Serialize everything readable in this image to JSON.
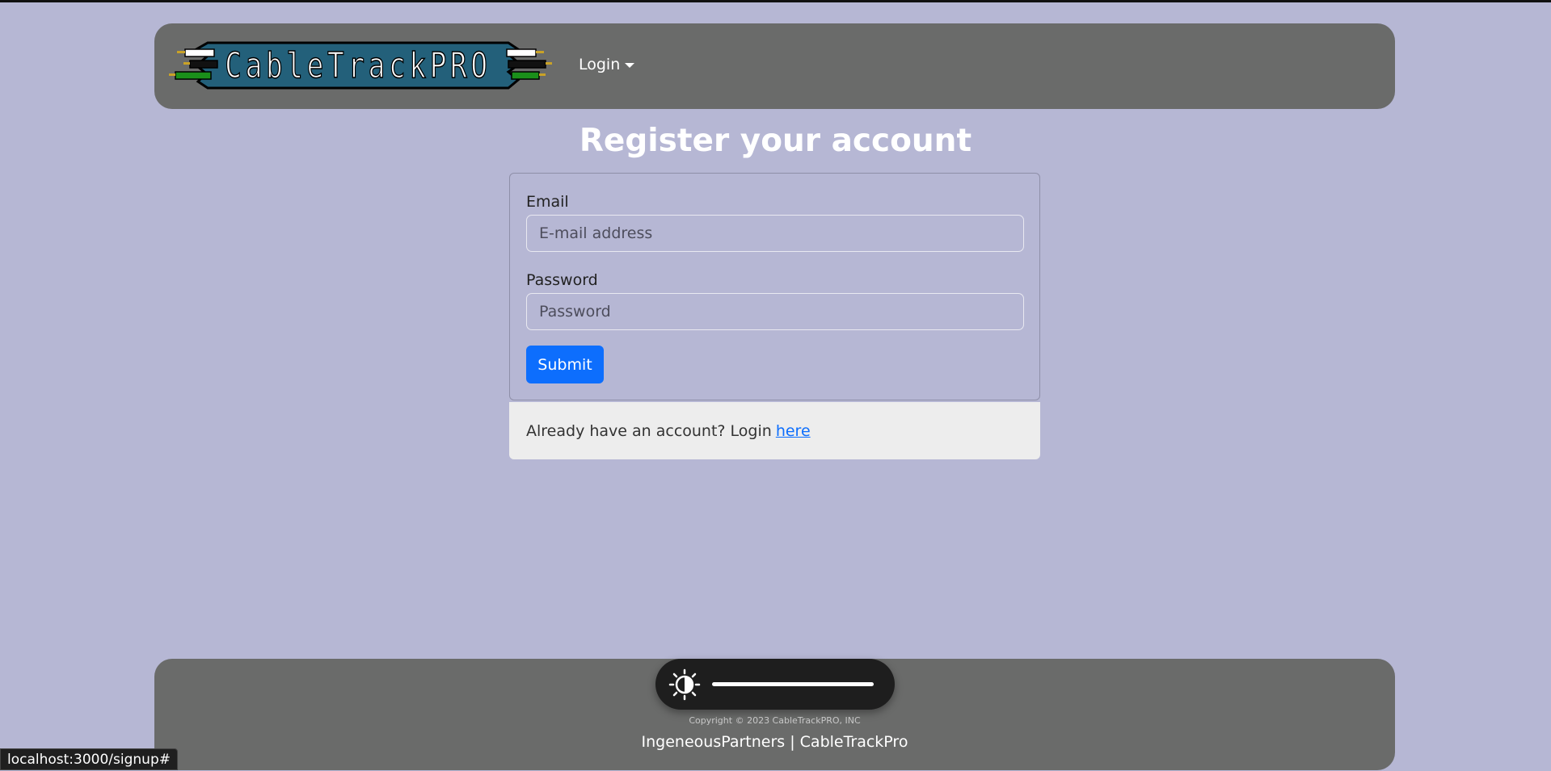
{
  "nav": {
    "logo_text": "CableTrackPRO",
    "login_menu_label": "Login"
  },
  "page": {
    "title": "Register your account"
  },
  "form": {
    "email_label": "Email",
    "email_placeholder": "E-mail address",
    "email_value": "",
    "password_label": "Password",
    "password_placeholder": "Password",
    "password_value": "",
    "submit_label": "Submit"
  },
  "login_prompt": {
    "text": "Already have an account? Login",
    "link_text": "here"
  },
  "footer": {
    "brightness_icon": "brightness-contrast-icon",
    "brightness_level": 1.0,
    "copyright": "Copyright © 2023 CableTrackPRO, INC",
    "links": "IngeneousPartners | CableTrackPro"
  },
  "status_bar": {
    "url": "localhost:3000/signup#"
  },
  "colors": {
    "background": "#b6b7d4",
    "navbar": "#6a6b6a",
    "logo_banner": "#23607a",
    "primary_button": "#0d6efd"
  }
}
